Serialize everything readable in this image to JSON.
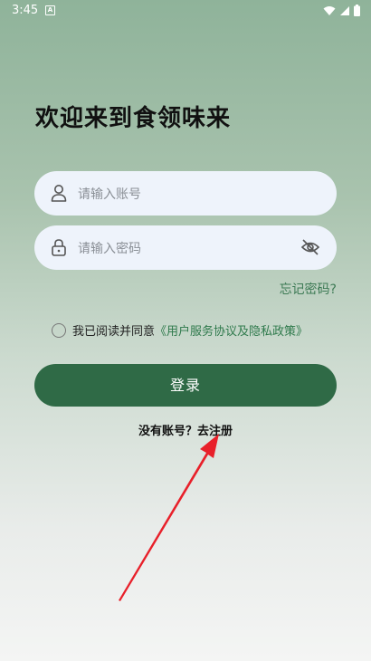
{
  "status_bar": {
    "time": "3:45",
    "app_icon_letter": "A"
  },
  "login": {
    "title": "欢迎来到食领味来",
    "account_placeholder": "请输入账号",
    "password_placeholder": "请输入密码",
    "forgot_password": "忘记密码?",
    "agreement_prefix": "我已阅读并同意",
    "agreement_link": "《用户服务协议及隐私政策》",
    "login_button": "登录",
    "register_prompt": "没有账号？",
    "register_link": "去注册"
  },
  "colors": {
    "primary": "#2f6a46",
    "link": "#3d7a55",
    "input_bg": "#eef3fb",
    "annotation_arrow": "#e8202a"
  },
  "icons": {
    "account": "user-icon",
    "password": "lock-icon",
    "toggle_visibility": "eye-off-icon",
    "checkbox": "radio-circle-icon"
  }
}
